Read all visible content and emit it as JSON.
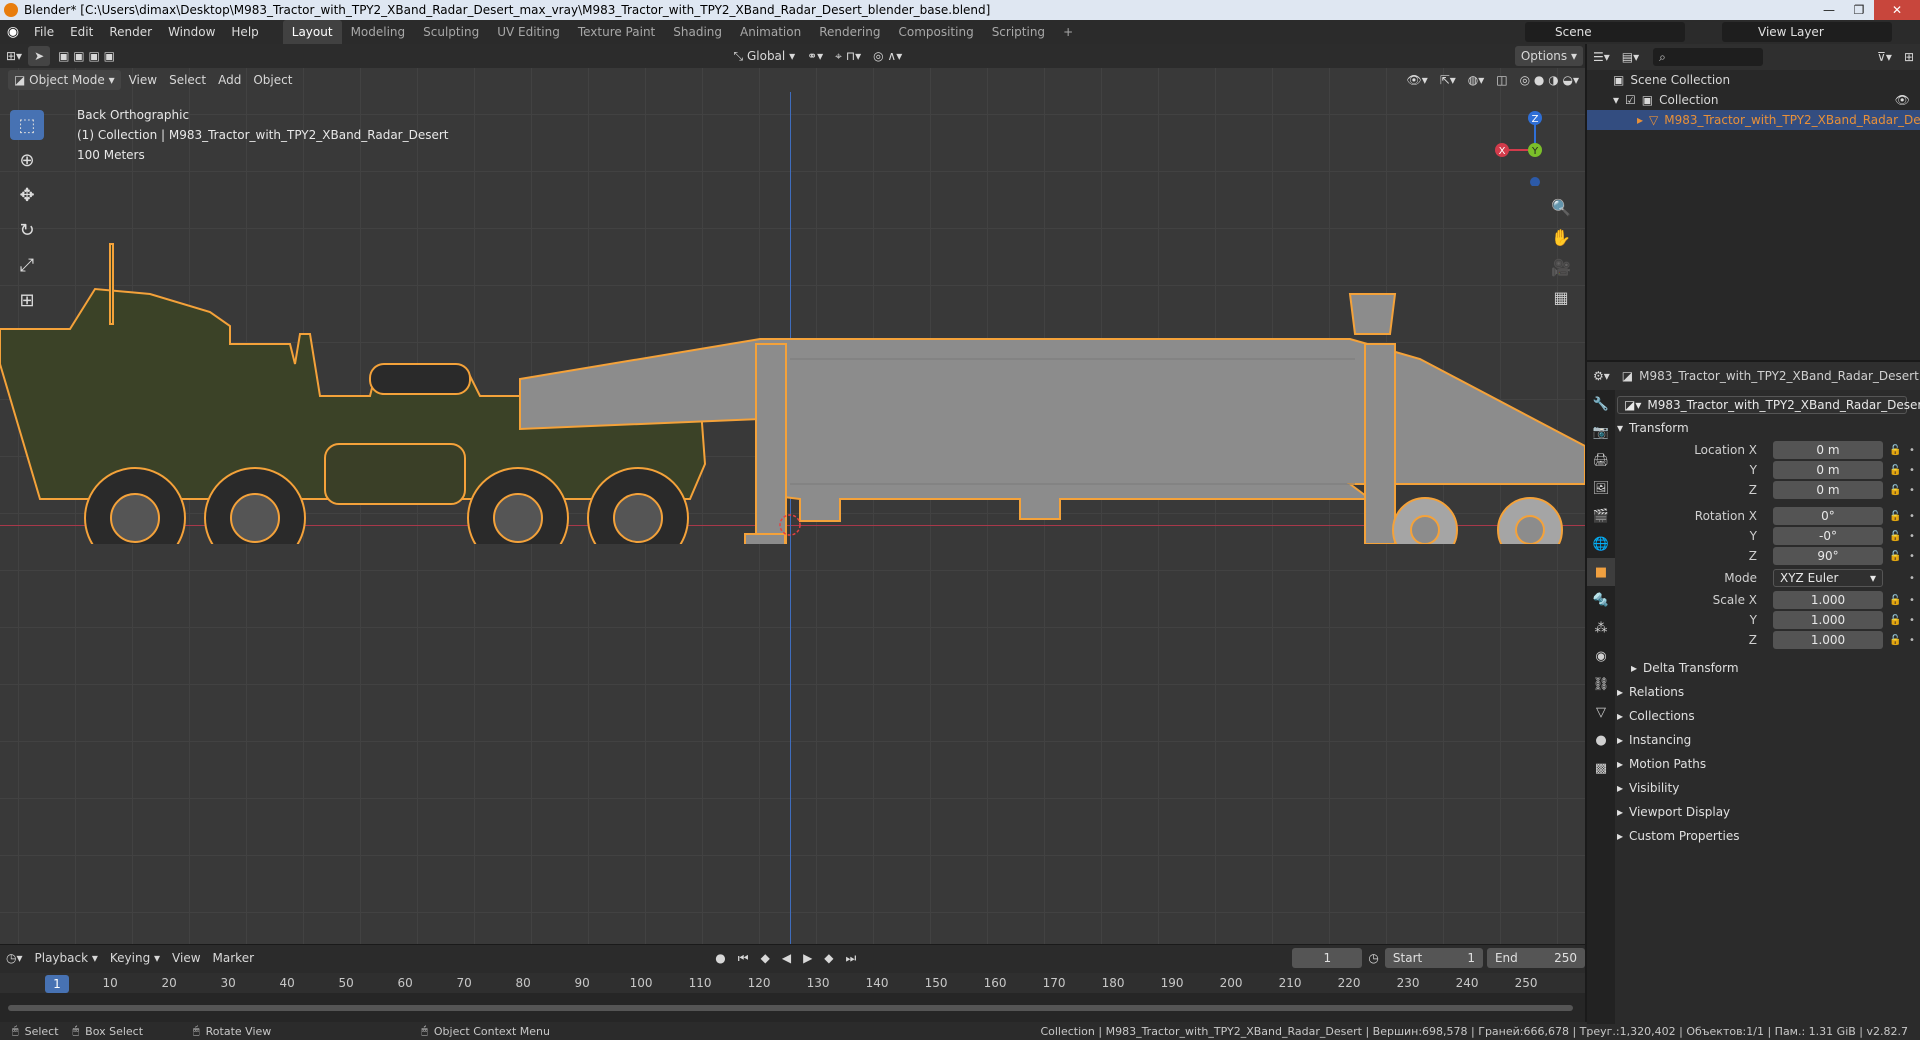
{
  "window": {
    "title": "Blender* [C:\\Users\\dimax\\Desktop\\M983_Tractor_with_TPY2_XBand_Radar_Desert_max_vray\\M983_Tractor_with_TPY2_XBand_Radar_Desert_blender_base.blend]"
  },
  "menu": [
    "File",
    "Edit",
    "Render",
    "Window",
    "Help"
  ],
  "workspaces": [
    "Layout",
    "Modeling",
    "Sculpting",
    "UV Editing",
    "Texture Paint",
    "Shading",
    "Animation",
    "Rendering",
    "Compositing",
    "Scripting"
  ],
  "scene": {
    "name": "Scene",
    "view_layer": "View Layer"
  },
  "viewport": {
    "mode": "Object Mode",
    "menus": [
      "View",
      "Select",
      "Add",
      "Object"
    ],
    "orientation": "Global",
    "options_label": "Options",
    "overlay_view": "Back Orthographic",
    "overlay_collection": "(1) Collection | M983_Tractor_with_TPY2_XBand_Radar_Desert",
    "overlay_scale": "100 Meters",
    "gizmo": {
      "x": "X",
      "y": "Y",
      "z": "Z"
    }
  },
  "outliner": {
    "scene_collection": "Scene Collection",
    "collection": "Collection",
    "object": "M983_Tractor_with_TPY2_XBand_Radar_De"
  },
  "properties": {
    "object_name": "M983_Tractor_with_TPY2_XBand_Radar_Desert",
    "data_name": "M983_Tractor_with_TPY2_XBand_Radar_Desert",
    "transform_label": "Transform",
    "location_label": "Location X",
    "location": [
      "0 m",
      "0 m",
      "0 m"
    ],
    "rotation_label": "Rotation X",
    "rotation": [
      "0°",
      "-0°",
      "90°"
    ],
    "mode_label": "Mode",
    "mode_value": "XYZ Euler",
    "scale_label": "Scale X",
    "scale": [
      "1.000",
      "1.000",
      "1.000"
    ],
    "axis_y": "Y",
    "axis_z": "Z",
    "delta_transform": "Delta Transform",
    "panels": [
      "Relations",
      "Collections",
      "Instancing",
      "Motion Paths",
      "Visibility",
      "Viewport Display",
      "Custom Properties"
    ]
  },
  "timeline": {
    "menus": [
      "Playback",
      "Keying",
      "View",
      "Marker"
    ],
    "current_frame": "1",
    "start_label": "Start",
    "start": "1",
    "end_label": "End",
    "end": "250",
    "ticks": [
      "1",
      "10",
      "20",
      "30",
      "40",
      "50",
      "60",
      "70",
      "80",
      "90",
      "100",
      "110",
      "120",
      "130",
      "140",
      "150",
      "160",
      "170",
      "180",
      "190",
      "200",
      "210",
      "220",
      "230",
      "240",
      "250"
    ]
  },
  "statusbar": {
    "select": "Select",
    "box_select": "Box Select",
    "rotate_view": "Rotate View",
    "context_menu": "Object Context Menu",
    "stats": "Collection | M983_Tractor_with_TPY2_XBand_Radar_Desert | Вершин:698,578 | Граней:666,678 | Треуг.:1,320,402 | Объектов:1/1 | Пам.: 1.31 GiB | v2.82.7"
  },
  "colors": {
    "selection_outline": "#f4a23a",
    "accent": "#4772b3",
    "truck_body": "#3b4227",
    "trailer_body": "#8c8c8c"
  }
}
